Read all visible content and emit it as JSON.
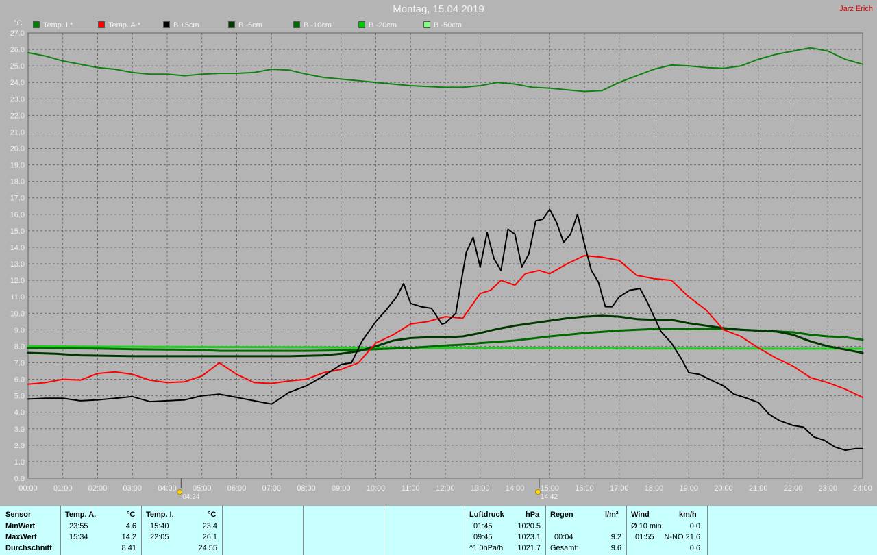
{
  "title": "Montag, 15.04.2019",
  "author": "Jarz Erich",
  "legend": [
    {
      "label": "Temp. I.*",
      "color": "#008000"
    },
    {
      "label": "Temp. A.*",
      "color": "#ff0000"
    },
    {
      "label": "B +5cm",
      "color": "#000000"
    },
    {
      "label": "B -5cm",
      "color": "#003800"
    },
    {
      "label": "B -10cm",
      "color": "#006a00"
    },
    {
      "label": "B -20cm",
      "color": "#00c800"
    },
    {
      "label": "B -50cm",
      "color": "#80ff80"
    }
  ],
  "chart_data": {
    "type": "line",
    "ylabel": "°C",
    "ylim": [
      0,
      27
    ],
    "xlim": [
      0,
      24
    ],
    "grid": true,
    "y_ticks": [
      "0.0",
      "1.0",
      "2.0",
      "3.0",
      "4.0",
      "5.0",
      "6.0",
      "7.0",
      "8.0",
      "9.0",
      "10.0",
      "11.0",
      "12.0",
      "13.0",
      "14.0",
      "15.0",
      "16.0",
      "17.0",
      "18.0",
      "19.0",
      "20.0",
      "21.0",
      "22.0",
      "23.0",
      "24.0",
      "25.0",
      "26.0",
      "27.0"
    ],
    "x_ticks": [
      "00:00",
      "01:00",
      "02:00",
      "03:00",
      "04:00",
      "05:00",
      "06:00",
      "07:00",
      "08:00",
      "09:00",
      "10:00",
      "11:00",
      "12:00",
      "13:00",
      "14:00",
      "15:00",
      "16:00",
      "17:00",
      "18:00",
      "19:00",
      "20:00",
      "21:00",
      "22:00",
      "23:00",
      "24:00"
    ],
    "markers": [
      {
        "time": "04:24",
        "hour": 4.4,
        "icon": "sunrise-icon"
      },
      {
        "time": "14:42",
        "hour": 14.7,
        "icon": "sun-cloud-icon"
      }
    ],
    "series": [
      {
        "name": "Temp. I.*",
        "color": "#108010",
        "width": 2,
        "x": [
          0,
          0.5,
          1,
          1.5,
          2,
          2.5,
          3,
          3.5,
          4,
          4.5,
          5,
          5.5,
          6,
          6.5,
          7,
          7.5,
          8,
          8.5,
          9,
          9.5,
          10,
          10.5,
          11,
          11.5,
          12,
          12.5,
          13,
          13.5,
          14,
          14.5,
          15,
          15.5,
          16,
          16.5,
          17,
          17.5,
          18,
          18.5,
          19,
          19.5,
          20,
          20.5,
          21,
          21.5,
          22,
          22.5,
          23,
          23.5,
          24
        ],
        "y": [
          25.8,
          25.6,
          25.3,
          25.1,
          24.9,
          24.8,
          24.6,
          24.5,
          24.5,
          24.4,
          24.5,
          24.55,
          24.55,
          24.6,
          24.8,
          24.75,
          24.5,
          24.3,
          24.2,
          24.1,
          24.0,
          23.9,
          23.8,
          23.75,
          23.7,
          23.7,
          23.8,
          24.0,
          23.9,
          23.7,
          23.65,
          23.55,
          23.45,
          23.5,
          24.0,
          24.4,
          24.8,
          25.05,
          25.0,
          24.9,
          24.85,
          25.0,
          25.4,
          25.7,
          25.9,
          26.1,
          25.9,
          25.4,
          25.1
        ]
      },
      {
        "name": "Temp. A.*",
        "color": "#ff0000",
        "width": 2,
        "x": [
          0,
          0.5,
          1,
          1.5,
          2,
          2.5,
          3,
          3.5,
          4,
          4.5,
          5,
          5.5,
          6,
          6.5,
          7,
          7.5,
          8,
          8.5,
          9,
          9.5,
          10,
          10.5,
          11,
          11.5,
          12,
          12.5,
          13,
          13.3,
          13.6,
          14,
          14.3,
          14.7,
          15,
          15.5,
          16,
          16.5,
          17,
          17.5,
          18,
          18.5,
          19,
          19.5,
          20,
          20.5,
          21,
          21.5,
          22,
          22.5,
          23,
          23.5,
          24
        ],
        "y": [
          5.7,
          5.8,
          6.0,
          5.95,
          6.35,
          6.45,
          6.3,
          5.95,
          5.8,
          5.85,
          6.2,
          7.0,
          6.3,
          5.8,
          5.75,
          5.9,
          6.0,
          6.4,
          6.6,
          7.0,
          8.2,
          8.7,
          9.35,
          9.5,
          9.8,
          9.7,
          11.2,
          11.4,
          12.0,
          11.7,
          12.4,
          12.6,
          12.4,
          13.0,
          13.5,
          13.4,
          13.2,
          12.3,
          12.1,
          12.0,
          11.0,
          10.2,
          9.0,
          8.6,
          7.9,
          7.3,
          6.8,
          6.1,
          5.8,
          5.4,
          4.9
        ]
      },
      {
        "name": "B +5cm",
        "color": "#000000",
        "width": 2,
        "x": [
          0,
          0.5,
          1,
          1.5,
          2,
          2.5,
          3,
          3.5,
          4,
          4.5,
          5,
          5.5,
          6,
          6.5,
          7,
          7.5,
          8,
          8.5,
          9,
          9.3,
          9.6,
          10,
          10.3,
          10.6,
          10.8,
          11,
          11.3,
          11.6,
          11.9,
          12,
          12.3,
          12.6,
          12.8,
          13,
          13.2,
          13.4,
          13.6,
          13.8,
          14,
          14.2,
          14.4,
          14.6,
          14.8,
          15,
          15.2,
          15.4,
          15.6,
          15.8,
          16,
          16.2,
          16.4,
          16.6,
          16.8,
          17,
          17.3,
          17.6,
          17.8,
          18,
          18.2,
          18.5,
          18.8,
          19,
          19.3,
          19.6,
          20,
          20.3,
          20.6,
          21,
          21.3,
          21.6,
          22,
          22.3,
          22.6,
          22.9,
          23.2,
          23.5,
          23.8,
          24
        ],
        "y": [
          4.8,
          4.85,
          4.85,
          4.7,
          4.75,
          4.85,
          4.95,
          4.65,
          4.7,
          4.75,
          5.0,
          5.1,
          4.9,
          4.7,
          4.5,
          5.2,
          5.6,
          6.2,
          6.9,
          7.0,
          8.3,
          9.5,
          10.2,
          11.0,
          11.8,
          10.6,
          10.4,
          10.3,
          9.35,
          9.4,
          10.0,
          13.7,
          14.6,
          12.8,
          14.9,
          13.3,
          12.6,
          15.1,
          14.8,
          12.8,
          13.6,
          15.6,
          15.7,
          16.3,
          15.5,
          14.3,
          14.8,
          16.0,
          14.2,
          12.6,
          11.9,
          10.4,
          10.4,
          11.0,
          11.4,
          11.5,
          10.7,
          9.8,
          8.9,
          8.2,
          7.2,
          6.4,
          6.3,
          6.0,
          5.6,
          5.1,
          4.9,
          4.6,
          3.9,
          3.5,
          3.2,
          3.1,
          2.5,
          2.3,
          1.9,
          1.7,
          1.8,
          1.8
        ]
      },
      {
        "name": "B -5cm",
        "color": "#003800",
        "width": 3,
        "x": [
          0,
          0.8,
          1.5,
          3,
          4.5,
          6,
          7.5,
          8.5,
          9,
          9.5,
          10,
          10.5,
          11,
          11.5,
          12,
          12.5,
          13,
          13.5,
          14,
          14.5,
          15,
          15.5,
          16,
          16.5,
          17,
          17.5,
          18,
          18.5,
          19,
          19.5,
          20,
          20.5,
          21,
          21.5,
          22,
          22.5,
          23,
          23.5,
          24
        ],
        "y": [
          7.6,
          7.55,
          7.45,
          7.4,
          7.4,
          7.4,
          7.4,
          7.45,
          7.55,
          7.7,
          8.0,
          8.35,
          8.5,
          8.55,
          8.55,
          8.6,
          8.8,
          9.05,
          9.25,
          9.4,
          9.55,
          9.7,
          9.8,
          9.85,
          9.8,
          9.65,
          9.6,
          9.6,
          9.4,
          9.25,
          9.1,
          9.0,
          8.95,
          8.9,
          8.7,
          8.3,
          8.0,
          7.8,
          7.6
        ]
      },
      {
        "name": "B -10cm",
        "color": "#006a00",
        "width": 3,
        "x": [
          0,
          1,
          2,
          3,
          4,
          5,
          5.5,
          6,
          7,
          8,
          9,
          9.5,
          10,
          11,
          12,
          12.5,
          13,
          14,
          15,
          15.5,
          16,
          17,
          18,
          19,
          20,
          20.5,
          21,
          22,
          22.5,
          23,
          23.5,
          24
        ],
        "y": [
          7.9,
          7.88,
          7.86,
          7.82,
          7.8,
          7.78,
          7.72,
          7.72,
          7.72,
          7.72,
          7.75,
          7.78,
          7.82,
          7.9,
          8.05,
          8.1,
          8.2,
          8.35,
          8.6,
          8.7,
          8.8,
          8.95,
          9.05,
          9.05,
          9.05,
          9.0,
          8.95,
          8.85,
          8.7,
          8.6,
          8.55,
          8.4
        ]
      },
      {
        "name": "B -20cm",
        "color": "#20d020",
        "width": 3,
        "x": [
          0,
          4,
          8,
          9,
          10,
          12,
          14,
          16,
          18,
          20,
          22,
          24
        ],
        "y": [
          8.0,
          7.96,
          7.94,
          7.92,
          7.9,
          7.9,
          7.88,
          7.88,
          7.86,
          7.86,
          7.85,
          7.85
        ]
      }
    ]
  },
  "stats": {
    "sensor": {
      "label": "Sensor",
      "rows": [
        "MinWert",
        "MaxWert",
        "Durchschnitt"
      ]
    },
    "temp_a": {
      "label": "Temp. A.",
      "unit": "°C",
      "min_time": "23:55",
      "min_value": "4.6",
      "max_time": "15:34",
      "max_value": "14.2",
      "avg": "8.41"
    },
    "temp_i": {
      "label": "Temp. I.",
      "unit": "°C",
      "min_time": "15:40",
      "min_value": "23.4",
      "max_time": "22:05",
      "max_value": "26.1",
      "avg": "24.55"
    },
    "luftdruck": {
      "label": "Luftdruck",
      "unit": "hPa",
      "min_time": "01:45",
      "min_value": "1020.5",
      "max_time": "09:45",
      "max_value": "1023.1",
      "trend": "^1.0hPa/h",
      "avg": "1021.7"
    },
    "regen": {
      "label": "Regen",
      "unit": "l/m²",
      "r2_time": "00:04",
      "r2_value": "9.2",
      "total_label": "Gesamt:",
      "total_value": "9.6"
    },
    "wind": {
      "label": "Wind",
      "unit": "km/h",
      "r1_label": "Ø 10 min.",
      "r1_value": "0.0",
      "r2_time": "01:55",
      "r2_value": "N-NO 21.6",
      "r3_value": "0.6"
    }
  }
}
